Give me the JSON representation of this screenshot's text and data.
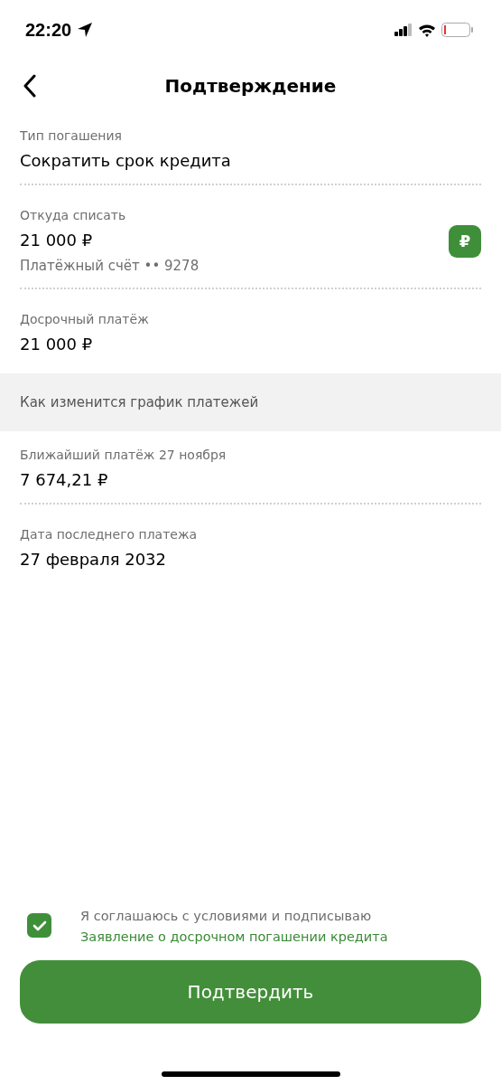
{
  "status_bar": {
    "time": "22:20"
  },
  "header": {
    "title": "Подтверждение"
  },
  "sections": [
    {
      "fields": [
        {
          "label": "Тип погашения",
          "value": "Сократить срок кредита"
        },
        {
          "label": "Откуда списать",
          "value": "21 000 ₽",
          "sub": "Платёжный счёт •• 9278",
          "badge": "₽"
        },
        {
          "label": "Досрочный платёж",
          "value": "21 000 ₽"
        }
      ]
    },
    {
      "title": "Как изменится график платежей",
      "fields": [
        {
          "label": "Ближайший платёж 27 ноября",
          "value": "7 674,21 ₽"
        },
        {
          "label": "Дата последнего платежа",
          "value": "27 февраля 2032"
        }
      ]
    }
  ],
  "agreement": {
    "checked": true,
    "text": "Я соглашаюсь с условиями и подписываю",
    "link": "Заявление о досрочном погашении кредита"
  },
  "confirm_button": "Подтвердить"
}
